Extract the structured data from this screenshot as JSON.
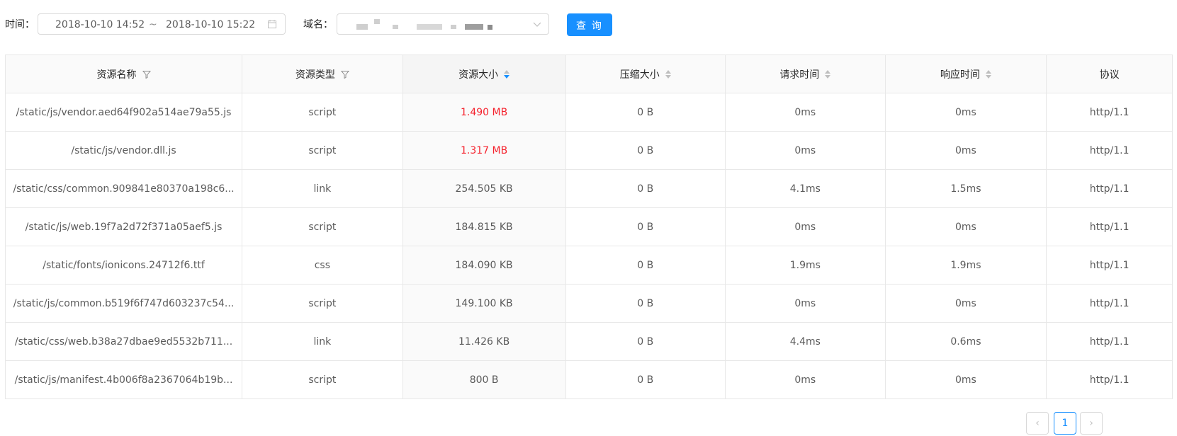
{
  "toolbar": {
    "time_label": "时间：",
    "date_start": "2018-10-10 14:52",
    "date_sep": "~",
    "date_end": "2018-10-10 15:22",
    "domain_label": "域名：",
    "query_button": "查 询"
  },
  "table": {
    "columns": [
      "资源名称",
      "资源类型",
      "资源大小",
      "压缩大小",
      "请求时间",
      "响应时间",
      "协议"
    ],
    "rows": [
      [
        "/static/js/vendor.aed64f902a514ae79a55.js",
        "script",
        "1.490 MB",
        "0 B",
        "0ms",
        "0ms",
        "http/1.1"
      ],
      [
        "/static/js/vendor.dll.js",
        "script",
        "1.317 MB",
        "0 B",
        "0ms",
        "0ms",
        "http/1.1"
      ],
      [
        "/static/css/common.909841e80370a198c6...",
        "link",
        "254.505 KB",
        "0 B",
        "4.1ms",
        "1.5ms",
        "http/1.1"
      ],
      [
        "/static/js/web.19f7a2d72f371a05aef5.js",
        "script",
        "184.815 KB",
        "0 B",
        "0ms",
        "0ms",
        "http/1.1"
      ],
      [
        "/static/fonts/ionicons.24712f6.ttf",
        "css",
        "184.090 KB",
        "0 B",
        "1.9ms",
        "1.9ms",
        "http/1.1"
      ],
      [
        "/static/js/common.b519f6f747d603237c54...",
        "script",
        "149.100 KB",
        "0 B",
        "0ms",
        "0ms",
        "http/1.1"
      ],
      [
        "/static/css/web.b38a27dbae9ed5532b711...",
        "link",
        "11.426 KB",
        "0 B",
        "4.4ms",
        "0.6ms",
        "http/1.1"
      ],
      [
        "/static/js/manifest.4b006f8a2367064b19b...",
        "script",
        "800 B",
        "0 B",
        "0ms",
        "0ms",
        "http/1.1"
      ]
    ]
  },
  "pagination": {
    "prev": "‹",
    "current": "1",
    "next": "›"
  },
  "colors": {
    "primary": "#1890ff",
    "highlight": "#f5222d"
  }
}
